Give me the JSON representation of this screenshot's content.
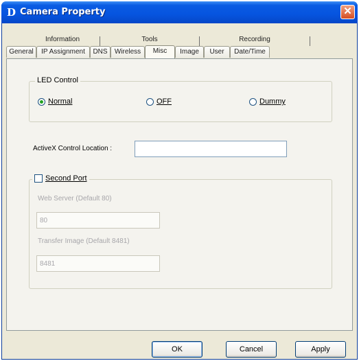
{
  "window": {
    "title": "Camera Property",
    "icon_glyph": "D",
    "close_glyph": "✕"
  },
  "tabs": {
    "upper": [
      "Information",
      "Tools",
      "Recording"
    ],
    "lower": [
      "General",
      "IP Assignment",
      "DNS",
      "Wireless",
      "Misc",
      "Image",
      "User",
      "Date/Time"
    ],
    "active": "Misc"
  },
  "led_control": {
    "legend": "LED Control",
    "options": [
      {
        "label": "Normal",
        "checked": true
      },
      {
        "label": "OFF",
        "checked": false
      },
      {
        "label": "Dummy",
        "checked": false
      }
    ]
  },
  "activex": {
    "label": "ActiveX Control Location :",
    "value": ""
  },
  "second_port": {
    "checkbox_label": "Second Port",
    "checked": false,
    "web_server_label": "Web Server (Default 80)",
    "web_server_value": "80",
    "transfer_label": "Transfer Image (Default 8481)",
    "transfer_value": "8481"
  },
  "buttons": {
    "ok": "OK",
    "cancel": "Cancel",
    "apply": "Apply"
  },
  "colors": {
    "titlebar": "#0654df",
    "dialog_bg": "#ece9d8",
    "close_button": "#d64e22"
  }
}
